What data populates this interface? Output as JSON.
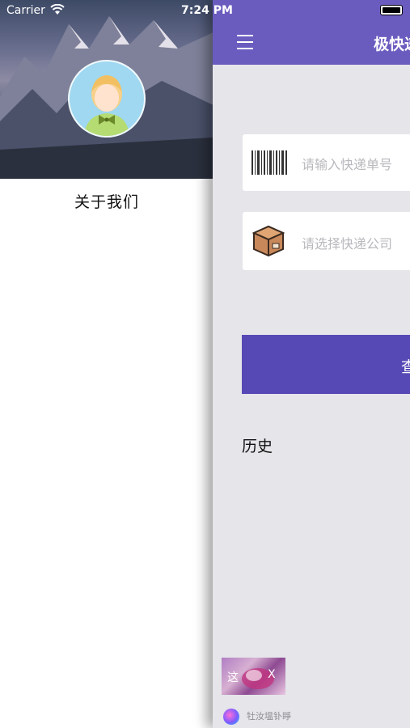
{
  "status_bar": {
    "carrier": "Carrier",
    "time": "7:24 PM"
  },
  "drawer": {
    "about_label": "关于我们"
  },
  "navbar": {
    "title": "极快递"
  },
  "form": {
    "tracking_number_placeholder": "请输入快递单号",
    "company_placeholder": "请选择快递公司",
    "query_button_label": "查"
  },
  "history": {
    "heading": "历史"
  },
  "ad": {
    "thumb_text": "这",
    "close_label": "X",
    "brand_text": "牡汝塭钋睜"
  },
  "colors": {
    "navbar": "#6a5cbf",
    "query_button": "#5649b6",
    "main_background": "#e5e5ea"
  }
}
